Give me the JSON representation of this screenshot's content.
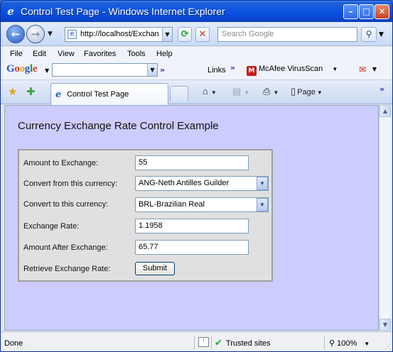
{
  "window": {
    "title": "Control Test Page - Windows Internet Explorer",
    "minimize_glyph": "–",
    "maximize_glyph": "□",
    "close_glyph": "✕"
  },
  "navbar": {
    "address": "http://localhost/Exchan",
    "search_placeholder": "Search Google"
  },
  "menu": [
    "File",
    "Edit",
    "View",
    "Favorites",
    "Tools",
    "Help"
  ],
  "google_toolbar": {
    "logo": [
      "G",
      "o",
      "o",
      "g",
      "l",
      "e"
    ],
    "links_label": "Links",
    "mcafee_label": "McAfee VirusScan"
  },
  "tabs": {
    "active_tab": "Control Test Page",
    "page_label": "Page"
  },
  "page": {
    "title": "Currency Exchange Rate Control Example",
    "form": {
      "amount_label": "Amount to Exchange:",
      "amount_value": "55",
      "from_label": "Convert from this currency:",
      "from_value": "ANG-Neth Antilles Guilder",
      "to_label": "Convert to this currency:",
      "to_value": "BRL-Brazilian Real",
      "rate_label": "Exchange Rate:",
      "rate_value": "1.1958",
      "after_label": "Amount After Exchange:",
      "after_value": "65.77",
      "retrieve_label": "Retrieve Exchange Rate:",
      "submit_label": "Submit"
    }
  },
  "statusbar": {
    "status": "Done",
    "zone": "Trusted sites",
    "zoom": "100%"
  },
  "colors": {
    "content_background": "#ccccff",
    "titlebar": "#0a53e0"
  }
}
